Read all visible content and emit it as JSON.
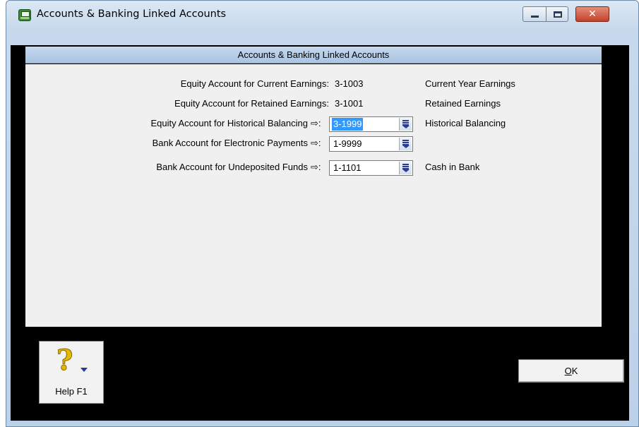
{
  "window": {
    "title": "Accounts & Banking Linked Accounts",
    "close_glyph": "✕"
  },
  "panel": {
    "header": "Accounts & Banking Linked Accounts",
    "rows": [
      {
        "label": "Equity Account for Current Earnings:",
        "value": "3-1003",
        "description": "Current Year Earnings",
        "editable": false
      },
      {
        "label": "Equity Account for Retained Earnings:",
        "value": "3-1001",
        "description": "Retained Earnings",
        "editable": false
      },
      {
        "label": "Equity Account for Historical Balancing",
        "arrow": "⇨:",
        "value": "3-1999",
        "description": "Historical Balancing",
        "editable": true,
        "selected": true
      },
      {
        "label": "Bank Account for Electronic Payments",
        "arrow": "⇨:",
        "value": "1-9999",
        "description": "",
        "editable": true
      },
      {
        "label": "Bank Account for Undeposited Funds",
        "arrow": "⇨:",
        "value": "1-1101",
        "description": "Cash in Bank",
        "editable": true
      }
    ]
  },
  "buttons": {
    "help_label": "Help F1",
    "help_glyph": "?",
    "ok_label": "OK",
    "ok_accel": "O",
    "ok_rest": "K"
  },
  "colors": {
    "selection": "#3399ff",
    "header_bar": "#a9c4e2",
    "panel_bg": "#f0f0f0",
    "client_bg": "#000000"
  }
}
